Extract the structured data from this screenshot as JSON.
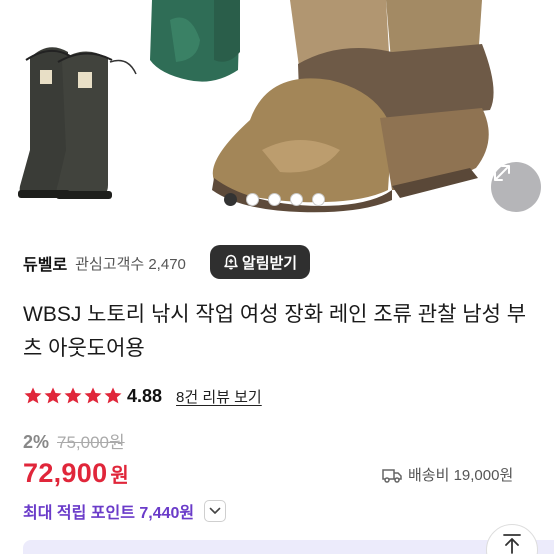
{
  "gallery": {
    "image_description_icon": "boots-product-image",
    "dots": [
      true,
      false,
      false,
      false,
      false
    ]
  },
  "seller": {
    "name": "듀벨로",
    "followers": "관심고객수 2,470",
    "alarm_label": "알림받기"
  },
  "product": {
    "title": "WBSJ 노토리 낚시 작업 여성 장화 레인 조류 관찰 남성 부츠 아웃도어용"
  },
  "rating": {
    "stars": 5,
    "value": "4.88",
    "review_link": "8건 리뷰 보기"
  },
  "price": {
    "discount": "2%",
    "original": "75,000원",
    "current": "72,900",
    "unit": "원",
    "shipping": "배송비 19,000원"
  },
  "points": {
    "label": "최대 적립 포인트 7,440원"
  },
  "colors": {
    "price_red": "#e0263a",
    "points_purple": "#6a3bc9",
    "star_red": "#e0263a"
  }
}
